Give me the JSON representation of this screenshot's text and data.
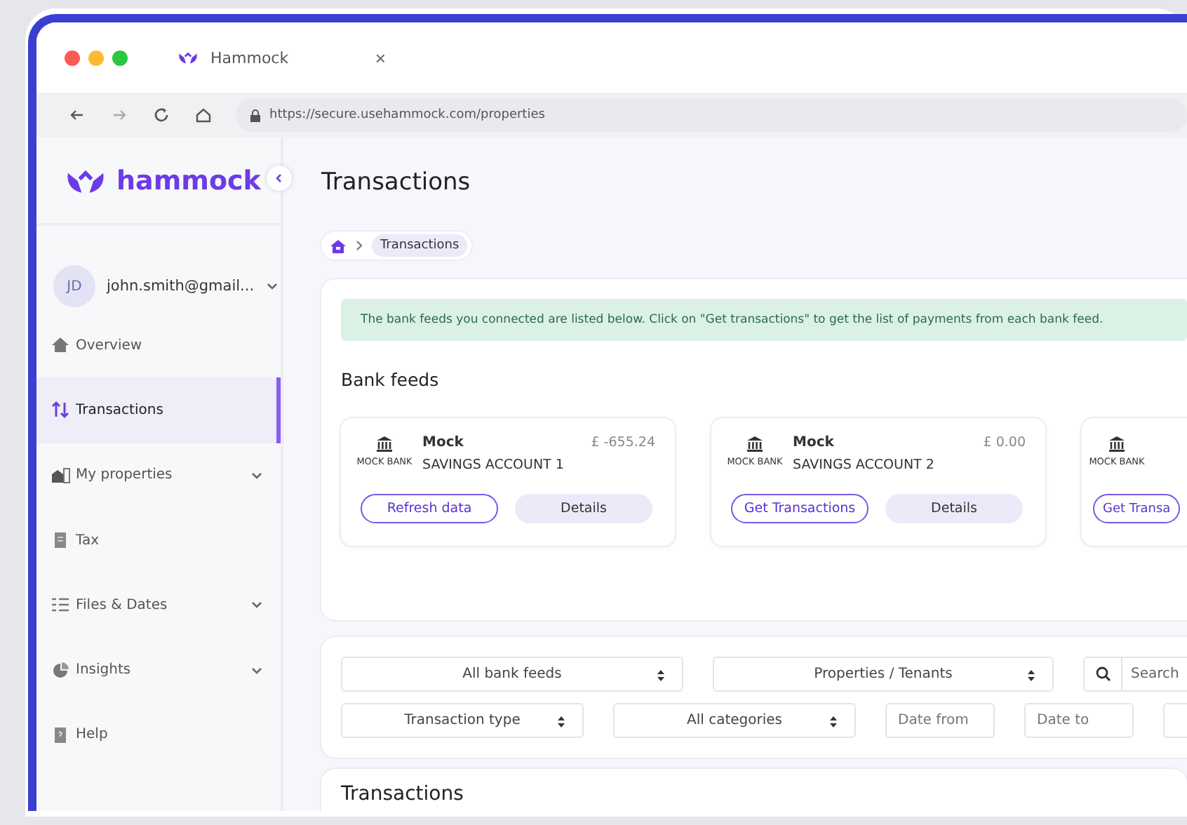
{
  "browser": {
    "tab_title": "Hammock",
    "tab_close": "×",
    "url": "https://secure.usehammock.com/properties"
  },
  "sidebar": {
    "logo": "hammock",
    "user": {
      "initials": "JD",
      "email": "john.smith@gmail..."
    },
    "items": [
      {
        "label": "Overview",
        "selected": false,
        "expandable": false
      },
      {
        "label": "Transactions",
        "selected": true,
        "expandable": false
      },
      {
        "label": "My properties",
        "selected": false,
        "expandable": true
      },
      {
        "label": "Tax",
        "selected": false,
        "expandable": false
      },
      {
        "label": "Files & Dates",
        "selected": false,
        "expandable": true
      },
      {
        "label": "Insights",
        "selected": false,
        "expandable": true
      },
      {
        "label": "Help",
        "selected": false,
        "expandable": false
      }
    ]
  },
  "page": {
    "title": "Transactions",
    "breadcrumb": [
      "Transactions"
    ]
  },
  "notice": "The bank feeds you connected are listed below. Click on \"Get transactions\" to get the list of payments from each bank feed.",
  "bank_feeds": {
    "title": "Bank feeds",
    "cards": [
      {
        "bank_label": "MOCK BANK",
        "bank_name": "Mock",
        "account": "SAVINGS ACCOUNT 1",
        "balance": "£ -655.24",
        "actions": [
          {
            "label": "Refresh data",
            "kind": "outline"
          },
          {
            "label": "Details",
            "kind": "soft"
          }
        ]
      },
      {
        "bank_label": "MOCK BANK",
        "bank_name": "Mock",
        "account": "SAVINGS ACCOUNT 2",
        "balance": "£ 0.00",
        "actions": [
          {
            "label": "Get Transactions",
            "kind": "outline"
          },
          {
            "label": "Details",
            "kind": "soft"
          }
        ]
      },
      {
        "bank_label": "MOCK BANK",
        "actions": [
          {
            "label": "Get Transa",
            "kind": "outline"
          }
        ]
      }
    ]
  },
  "filters": [
    [
      {
        "kind": "select",
        "label": "All bank feeds"
      },
      {
        "kind": "select",
        "label": "Properties / Tenants"
      },
      {
        "kind": "search",
        "placeholder": "Search"
      }
    ],
    [
      {
        "kind": "select",
        "label": "Transaction type"
      },
      {
        "kind": "select",
        "label": "All categories"
      },
      {
        "kind": "date",
        "placeholder": "Date from"
      },
      {
        "kind": "date",
        "placeholder": "Date to"
      },
      {
        "kind": "date"
      }
    ]
  ],
  "transactions": {
    "title": "Transactions"
  }
}
